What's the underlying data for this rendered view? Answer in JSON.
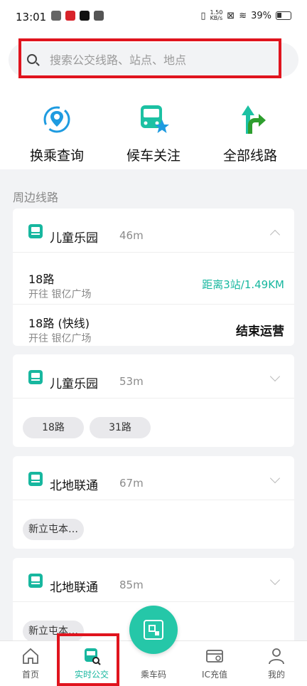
{
  "status_bar": {
    "time": "13:01",
    "speed_top": "1.50",
    "speed_bottom": "KB/s",
    "battery": "39%"
  },
  "search": {
    "placeholder": "搜索公交线路、站点、地点"
  },
  "quick_actions": [
    {
      "label": "换乘查询",
      "icon": "transfer-location-icon"
    },
    {
      "label": "候车关注",
      "icon": "bus-star-icon"
    },
    {
      "label": "全部线路",
      "icon": "all-routes-arrow-icon"
    }
  ],
  "nearby": {
    "title": "周边线路",
    "stops": [
      {
        "name": "儿童乐园",
        "distance": "46m",
        "expanded": true,
        "routes": [
          {
            "name": "18路",
            "direction": "开往 银亿广场",
            "status": "距离3站/1.49KM"
          },
          {
            "name": "18路 (快线)",
            "direction": "开往 银亿广场",
            "status": "结束运营"
          }
        ]
      },
      {
        "name": "儿童乐园",
        "distance": "53m",
        "expanded": false,
        "chips": [
          "18路",
          "31路"
        ]
      },
      {
        "name": "北地联通",
        "distance": "67m",
        "expanded": false,
        "chips": [
          "新立屯本…"
        ]
      },
      {
        "name": "北地联通",
        "distance": "85m",
        "expanded": false,
        "chips": [
          "新立屯本…"
        ]
      }
    ]
  },
  "tabbar": {
    "items": [
      {
        "label": "首页",
        "icon": "home-icon"
      },
      {
        "label": "实时公交",
        "icon": "realtime-bus-icon"
      },
      {
        "label": "乘车码",
        "icon": "qr-code-icon"
      },
      {
        "label": "IC充值",
        "icon": "card-recharge-icon"
      },
      {
        "label": "我的",
        "icon": "profile-icon"
      }
    ],
    "active_index": 1
  },
  "colors": {
    "accent": "#17b79f",
    "fab": "#25c7a8",
    "highlight": "#e0141e",
    "blue": "#1e9be0"
  }
}
